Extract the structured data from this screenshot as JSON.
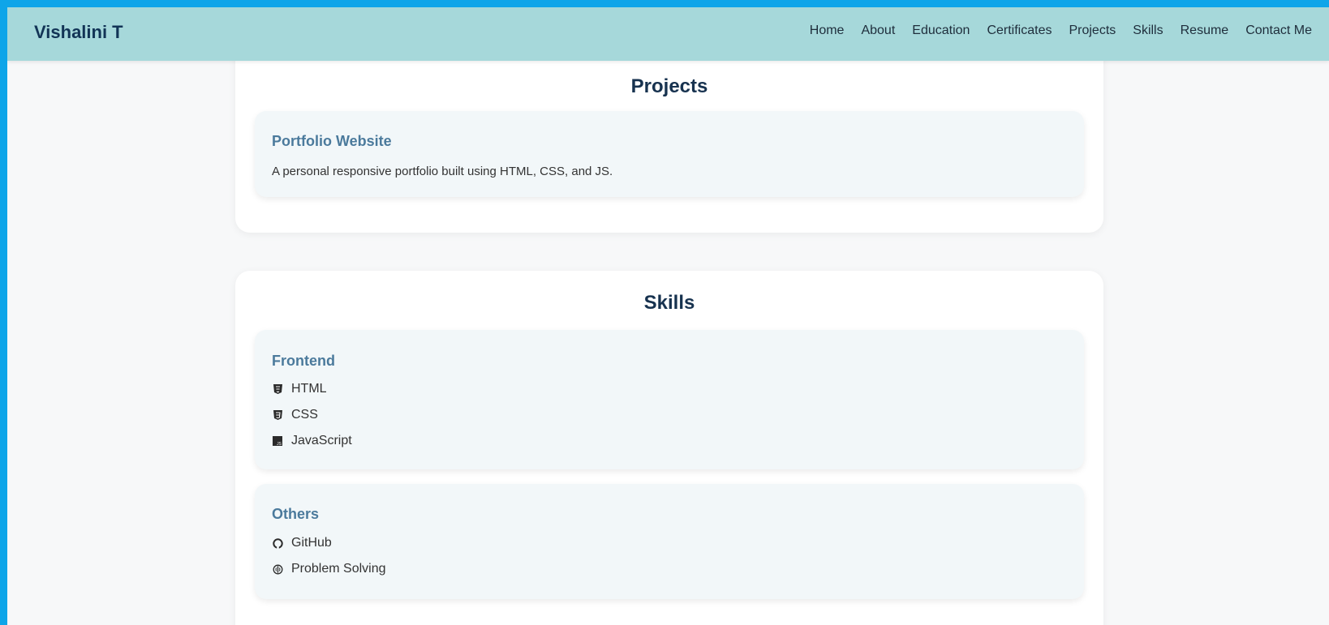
{
  "brand": "Vishalini T",
  "nav": [
    "Home",
    "About",
    "Education",
    "Certificates",
    "Projects",
    "Skills",
    "Resume",
    "Contact Me"
  ],
  "projects": {
    "title": "Projects",
    "items": [
      {
        "title": "Portfolio Website",
        "description": "A personal responsive portfolio built using HTML, CSS, and JS."
      }
    ]
  },
  "skills": {
    "title": "Skills",
    "groups": [
      {
        "title": "Frontend",
        "items": [
          {
            "label": "HTML",
            "icon": "html5-icon"
          },
          {
            "label": "CSS",
            "icon": "css3-icon"
          },
          {
            "label": "JavaScript",
            "icon": "javascript-icon"
          }
        ]
      },
      {
        "title": "Others",
        "items": [
          {
            "label": "GitHub",
            "icon": "github-icon"
          },
          {
            "label": "Problem Solving",
            "icon": "problem-solving-icon"
          }
        ]
      }
    ]
  },
  "colors": {
    "outer_border": "#0ea5e9",
    "navbar_bg": "#a6d8da",
    "brand_text": "#123456",
    "heading": "#17324f",
    "card_title": "#4b7a9c"
  }
}
